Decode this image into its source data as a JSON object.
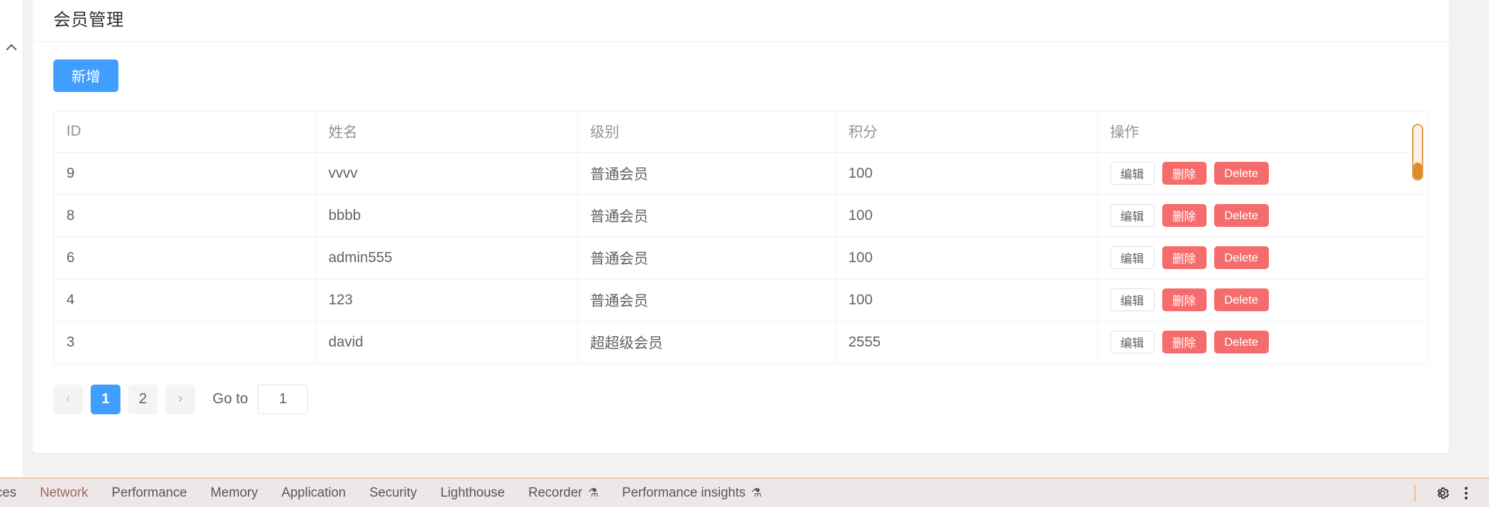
{
  "sidebar": {
    "collapse_icon": "chevron-up-icon"
  },
  "card": {
    "title": "会员管理",
    "add_button": "新增"
  },
  "table": {
    "columns": [
      "ID",
      "姓名",
      "级别",
      "积分",
      "操作"
    ],
    "rows": [
      {
        "id": "9",
        "name": "vvvv",
        "level": "普通会员",
        "points": "100",
        "edit": "编辑",
        "delete_cn": "删除",
        "delete_en": "Delete"
      },
      {
        "id": "8",
        "name": "bbbb",
        "level": "普通会员",
        "points": "100",
        "edit": "编辑",
        "delete_cn": "删除",
        "delete_en": "Delete"
      },
      {
        "id": "6",
        "name": "admin555",
        "level": "普通会员",
        "points": "100",
        "edit": "编辑",
        "delete_cn": "删除",
        "delete_en": "Delete"
      },
      {
        "id": "4",
        "name": "123",
        "level": "普通会员",
        "points": "100",
        "edit": "编辑",
        "delete_cn": "删除",
        "delete_en": "Delete"
      },
      {
        "id": "3",
        "name": "david",
        "level": "超超级会员",
        "points": "2555",
        "edit": "编辑",
        "delete_cn": "删除",
        "delete_en": "Delete"
      }
    ]
  },
  "pagination": {
    "prev": "‹",
    "pages": [
      "1",
      "2"
    ],
    "active_page": "1",
    "next": "›",
    "goto_label": "Go to",
    "goto_value": "1"
  },
  "devtools": {
    "tabs": [
      {
        "label": "ces",
        "clipped": true,
        "flask": false,
        "highlight": false
      },
      {
        "label": "Network",
        "clipped": false,
        "flask": false,
        "highlight": true
      },
      {
        "label": "Performance",
        "clipped": false,
        "flask": false,
        "highlight": false
      },
      {
        "label": "Memory",
        "clipped": false,
        "flask": false,
        "highlight": false
      },
      {
        "label": "Application",
        "clipped": false,
        "flask": false,
        "highlight": false
      },
      {
        "label": "Security",
        "clipped": false,
        "flask": false,
        "highlight": false
      },
      {
        "label": "Lighthouse",
        "clipped": false,
        "flask": false,
        "highlight": false
      },
      {
        "label": "Recorder",
        "clipped": false,
        "flask": true,
        "highlight": false
      },
      {
        "label": "Performance insights",
        "clipped": false,
        "flask": true,
        "highlight": false
      }
    ],
    "flask_glyph": "⚗",
    "settings_icon": "gear-icon",
    "more_icon": "kebab-menu-icon"
  },
  "colors": {
    "primary": "#409eff",
    "danger": "#f56c6c",
    "scrollbar_track": "#fdf2e2",
    "scrollbar_thumb": "#e0892a",
    "devtools_bg": "#eee7e8"
  }
}
